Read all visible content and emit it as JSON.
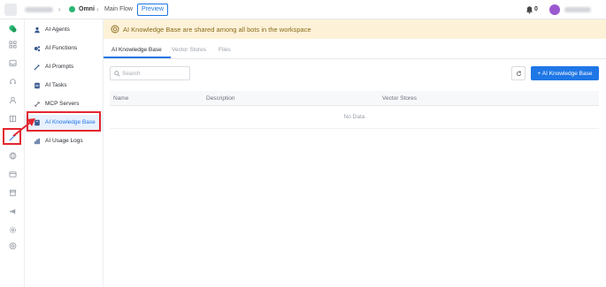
{
  "topbar": {
    "project": "Omni",
    "flow": "Main Flow",
    "preview_label": "Preview",
    "notification_count": "0"
  },
  "rail": {
    "icons": [
      "chat-icon",
      "grid-icon",
      "inbox-icon",
      "headset-icon",
      "user-icon",
      "book-icon",
      "ai-icon",
      "globe-icon",
      "card-icon",
      "box-icon",
      "megaphone-icon",
      "settings-icon",
      "help-icon"
    ],
    "active": "ai-icon"
  },
  "menu": {
    "items": [
      {
        "label": "AI Agents",
        "icon": "agent-icon"
      },
      {
        "label": "AI Functions",
        "icon": "function-icon"
      },
      {
        "label": "AI Prompts",
        "icon": "prompt-icon"
      },
      {
        "label": "AI Tasks",
        "icon": "task-icon"
      },
      {
        "label": "MCP Servers",
        "icon": "server-icon"
      },
      {
        "label": "AI Knowledge Base",
        "icon": "knowledge-icon"
      },
      {
        "label": "AI Usage Logs",
        "icon": "logs-icon"
      }
    ],
    "active_index": 5
  },
  "banner": {
    "text": "AI Knowledge Base are shared among all bots in the workspace",
    "color": "#8a6a1a"
  },
  "tabs": [
    {
      "label": "AI Knowledge Base"
    },
    {
      "label": "Vector Stores"
    },
    {
      "label": "Files"
    }
  ],
  "toolbar": {
    "search_placeholder": "Search",
    "add_label": "+ AI Knowledge Base"
  },
  "table": {
    "columns": [
      "Name",
      "Description",
      "Vector Stores"
    ],
    "empty_text": "No Data"
  },
  "colors": {
    "accent": "#1f77e6",
    "highlight": "#e3262f"
  }
}
